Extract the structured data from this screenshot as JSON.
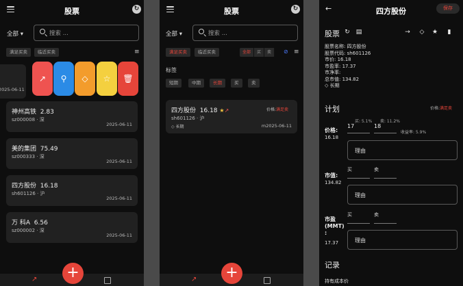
{
  "panel1": {
    "title": "股票",
    "filter_all": "全部",
    "search_placeholder": "搜索 ...",
    "chips": [
      "满足买卖",
      "临近买卖"
    ],
    "swiped_date": "2025-06-11",
    "swipe_colors": [
      "#ef5350",
      "#2b8be6",
      "#f39c2c",
      "#f4d03f",
      "#e6453a"
    ],
    "cards": [
      {
        "name": "神州高铁",
        "price": "2.83",
        "code": "sz000008 · 深",
        "date": "2025-06-11"
      },
      {
        "name": "美的集团",
        "price": "75.49",
        "code": "sz000333 · 深",
        "date": "2025-06-11"
      },
      {
        "name": "四方股份",
        "price": "16.18",
        "code": "sh601126 · 沪",
        "date": "2025-06-11"
      },
      {
        "name": "万 科A",
        "price": "6.56",
        "code": "sz000002 · 深",
        "date": "2025-06-11"
      }
    ],
    "fab": "+"
  },
  "panel2": {
    "title": "股票",
    "filter_all": "全部",
    "search_placeholder": "搜索 ...",
    "chips": [
      "满足买卖",
      "临近买卖"
    ],
    "seg": [
      "全部",
      "买",
      "卖"
    ],
    "tags_title": "标签",
    "tags": [
      "短期",
      "中期",
      "长期",
      "买",
      "卖"
    ],
    "card": {
      "name": "四方股份",
      "price": "16.18",
      "code": "sh601126 · 沪",
      "status_label": "价格:",
      "status_value": "满足卖",
      "tag": "长期",
      "date": "m2025-06-11"
    },
    "fab": "+"
  },
  "panel3": {
    "title": "四方股份",
    "save": "保存",
    "section_stock": "股票",
    "info": [
      "股票名称:  四方股份",
      "股票代码:  sh601126",
      "市价:  16.18",
      "市盈率:  17.37",
      "市净率:",
      "总市值:  134.82"
    ],
    "tag": "长期",
    "section_plan": "计划",
    "plan_status_label": "价格:",
    "plan_status_value": "满足卖",
    "price_label": "价格:",
    "price_value": "16.18",
    "buy_pct": "买: 5.1%",
    "sell_pct": "卖: 11.2%",
    "buy_price": "17",
    "sell_price": "18",
    "yield": "收益率: 5.9%",
    "reason": "理由",
    "mcap_label": "市值:",
    "mcap_value": "134.82",
    "buy": "买",
    "sell": "卖",
    "pe_label": "市盈\n(MMT)\n:",
    "pe_value": "17.37",
    "section_record": "记录",
    "cost_label": "持有成本价"
  }
}
